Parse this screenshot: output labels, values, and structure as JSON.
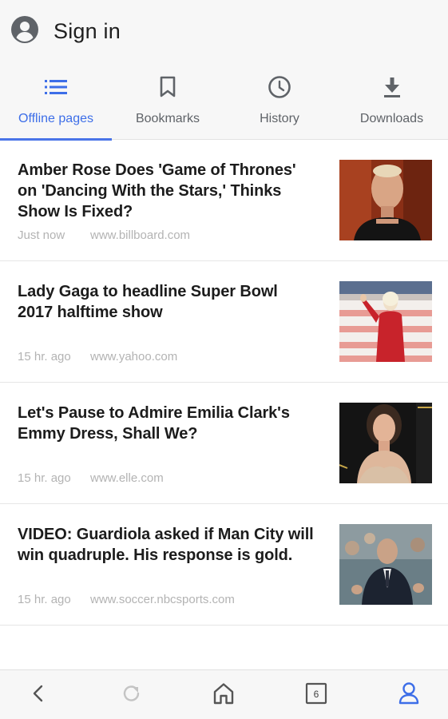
{
  "header": {
    "signin_label": "Sign in"
  },
  "tabs": [
    {
      "label": "Offline pages",
      "icon": "list-icon",
      "active": true
    },
    {
      "label": "Bookmarks",
      "icon": "bookmark-icon",
      "active": false
    },
    {
      "label": "History",
      "icon": "clock-icon",
      "active": false
    },
    {
      "label": "Downloads",
      "icon": "download-icon",
      "active": false
    }
  ],
  "articles": [
    {
      "title": "Amber Rose Does 'Game of Thrones' on 'Dancing With the Stars,' Thinks Show Is Fixed?",
      "time": "Just now",
      "source": "www.billboard.com"
    },
    {
      "title": "Lady Gaga to headline Super Bowl 2017 halftime show",
      "time": "15 hr. ago",
      "source": "www.yahoo.com"
    },
    {
      "title": "Let's Pause to Admire Emilia Clark's Emmy Dress, Shall We?",
      "time": "15 hr. ago",
      "source": "www.elle.com"
    },
    {
      "title": "VIDEO: Guardiola asked if Man City will win quadruple. His response is gold.",
      "time": "15 hr. ago",
      "source": "www.soccer.nbcsports.com"
    }
  ],
  "bottom_nav": {
    "tab_count": "6",
    "icons": [
      "back-icon",
      "refresh-icon",
      "home-icon",
      "tabs-icon",
      "profile-icon"
    ]
  },
  "colors": {
    "accent": "#3d6ee8",
    "header_bg": "#f7f7f7",
    "meta_text": "#b3b3b3",
    "refresh_disabled": "#c4c4c4"
  }
}
